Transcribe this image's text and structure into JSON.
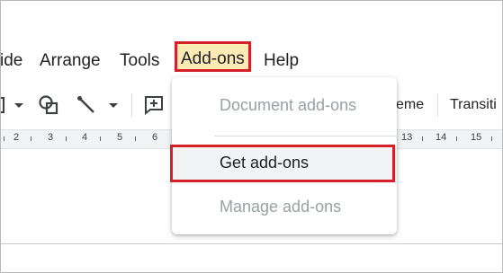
{
  "menubar": {
    "items": [
      "ide",
      "Arrange",
      "Tools",
      "Add-ons",
      "Help"
    ]
  },
  "toolbar": {
    "theme_label": "eme",
    "transition_label": "Transiti"
  },
  "ruler": {
    "numbers": [
      "2",
      "3",
      "4",
      "5",
      "6",
      "13",
      "14",
      "15"
    ]
  },
  "addons_menu": {
    "items": [
      {
        "label": "Document add-ons",
        "enabled": false
      },
      {
        "label": "Get add-ons",
        "enabled": true
      },
      {
        "label": "Manage add-ons",
        "enabled": false
      }
    ]
  },
  "colors": {
    "highlight_border": "#d32029",
    "active_menu_bg": "#fdebb6",
    "disabled_text": "#9aa0a6"
  }
}
